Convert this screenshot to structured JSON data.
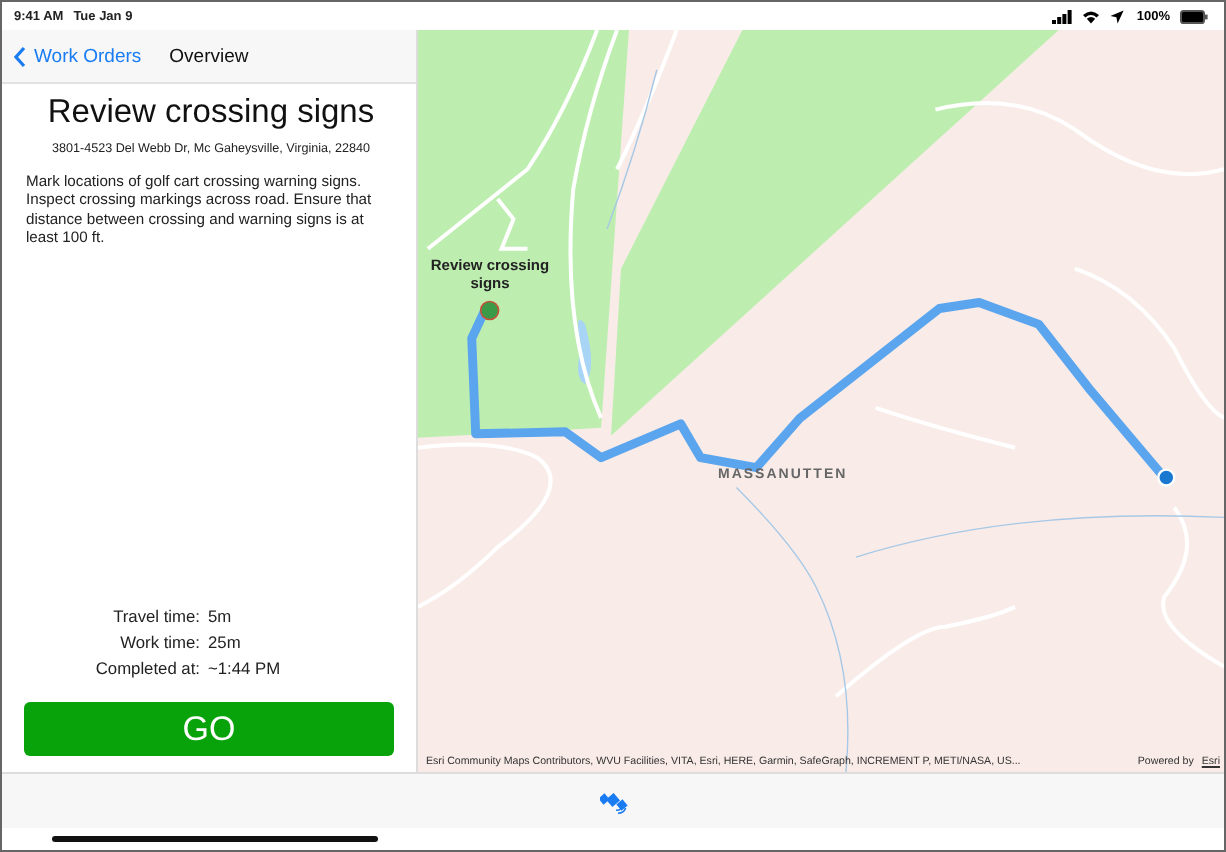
{
  "status_bar": {
    "time": "9:41 AM",
    "date": "Tue Jan 9",
    "battery": "100%"
  },
  "nav": {
    "back": "Work Orders",
    "title": "Overview"
  },
  "work_order": {
    "title": "Review crossing signs",
    "address": "3801-4523 Del Webb Dr, Mc Gaheysville, Virginia, 22840",
    "description": "Mark locations of golf cart crossing warning signs. Inspect crossing markings across road. Ensure that distance between crossing and warning signs is at least 100 ft.",
    "details": [
      {
        "label": "Travel time:",
        "value": "5m"
      },
      {
        "label": "Work time:",
        "value": "25m"
      },
      {
        "label": "Completed at:",
        "value": "~1:44 PM"
      }
    ],
    "go_button": "GO"
  },
  "map": {
    "callout": "Review crossing signs",
    "place_label": "MASSANUTTEN",
    "attribution": "Esri Community Maps Contributors, WVU Facilities, VITA, Esri, HERE, Garmin, SafeGraph, INCREMENT P, METI/NASA, US...",
    "powered_by": "Powered by",
    "powered_link": "Esri"
  }
}
